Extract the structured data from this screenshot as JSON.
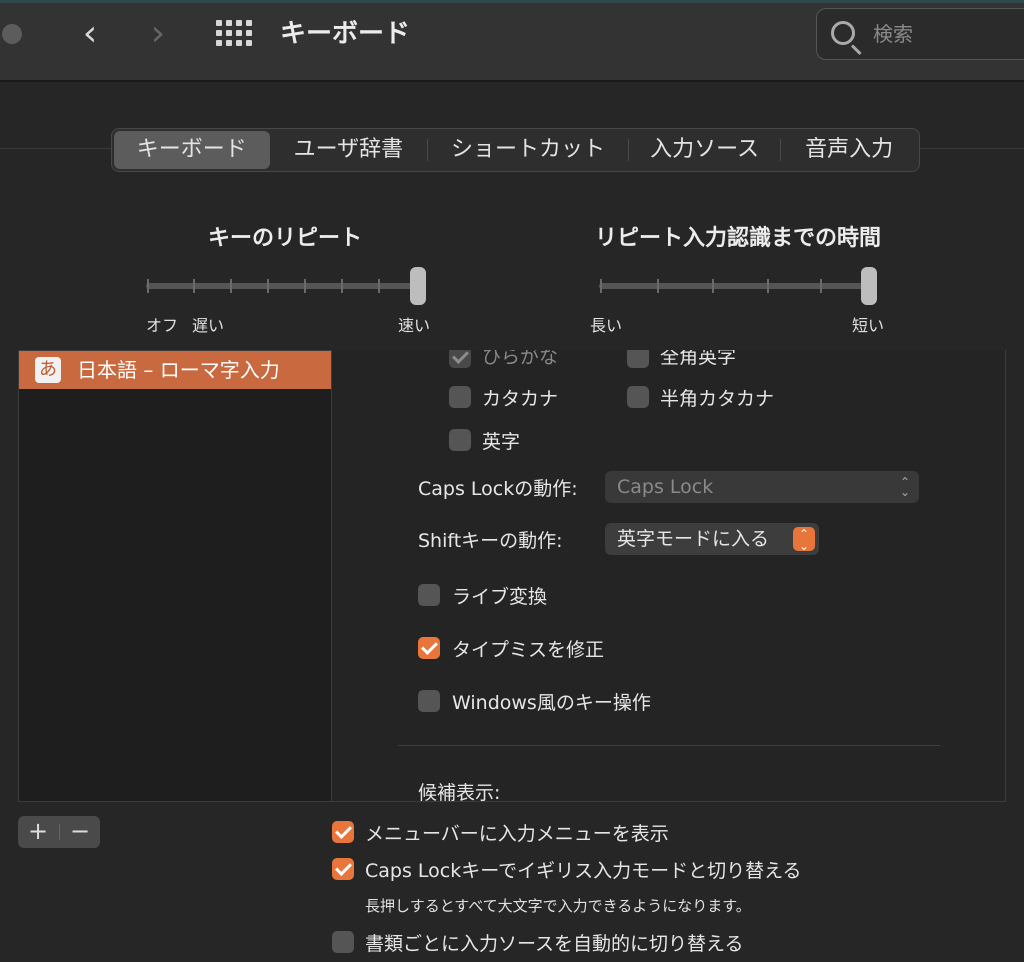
{
  "window": {
    "title": "キーボード",
    "search_placeholder": "検索"
  },
  "tabs": [
    {
      "label": "キーボード",
      "active": true
    },
    {
      "label": "ユーザ辞書",
      "active": false
    },
    {
      "label": "ショートカット",
      "active": false
    },
    {
      "label": "入力ソース",
      "active": false
    },
    {
      "label": "音声入力",
      "active": false
    }
  ],
  "key_repeat": {
    "label": "キーのリピート",
    "min_labels": [
      "オフ",
      "遅い"
    ],
    "max_label": "速い",
    "value_fraction": 1.0
  },
  "delay_until_repeat": {
    "label": "リピート入力認識までの時間",
    "min_label": "長い",
    "max_label": "短い",
    "value_fraction": 1.0
  },
  "input_sources": [
    {
      "badge": "あ",
      "label": "日本語 – ローマ字入力",
      "selected": true
    }
  ],
  "input_modes": {
    "hiragana": {
      "label": "ひらがな",
      "checked": true,
      "disabled": true
    },
    "zenkaku_eiji": {
      "label": "全角英字",
      "checked": false
    },
    "katakana": {
      "label": "カタカナ",
      "checked": false
    },
    "hankaku_katakana": {
      "label": "半角カタカナ",
      "checked": false
    },
    "eiji": {
      "label": "英字",
      "checked": false
    }
  },
  "caps_lock": {
    "label": "Caps Lockの動作:",
    "value": "Caps Lock"
  },
  "shift_key": {
    "label": "Shiftキーの動作:",
    "value": "英字モードに入る"
  },
  "options": {
    "live_conversion": {
      "label": "ライブ変換",
      "checked": false
    },
    "typo_correction": {
      "label": "タイプミスを修正",
      "checked": true
    },
    "windows_keys": {
      "label": "Windows風のキー操作",
      "checked": false
    }
  },
  "candidates_label": "候補表示:",
  "list_buttons": {
    "add": "+",
    "remove": "−"
  },
  "footer": {
    "show_menu": {
      "label": "メニューバーに入力メニューを表示",
      "checked": true
    },
    "caps_switch": {
      "label": "Caps Lockキーでイギリス入力モードと切り替える",
      "checked": true
    },
    "caps_note": "長押しするとすべて大文字で入力できるようになります。",
    "auto_switch": {
      "label": "書類ごとに入力ソースを自動的に切り替える",
      "checked": false
    }
  },
  "colors": {
    "accent": "#e8763b",
    "selection": "#c8693f"
  }
}
